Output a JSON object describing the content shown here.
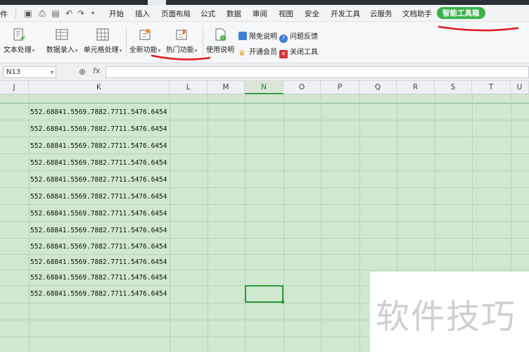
{
  "menubar": {
    "cut_text": "件",
    "items": [
      "开始",
      "插入",
      "页面布局",
      "公式",
      "数据",
      "审阅",
      "视图",
      "安全",
      "开发工具",
      "云服务",
      "文档助手",
      "智能工具箱"
    ],
    "active_item": "智能工具箱"
  },
  "ribbon": {
    "buttons": [
      "文本处理",
      "数据录入",
      "单元格处理",
      "全新功能",
      "热门功能",
      "使用说明"
    ],
    "items": [
      "限免说明",
      "问题反馈",
      "开通会员",
      "关闭工具"
    ]
  },
  "formula_bar": {
    "name_box": "N13",
    "fx_label": "fx",
    "formula": ""
  },
  "columns": [
    "J",
    "K",
    "L",
    "M",
    "N",
    "O",
    "P",
    "Q",
    "R",
    "S",
    "T",
    "U"
  ],
  "selected_column": "N",
  "cells": {
    "column": "K",
    "values": [
      "552.68841.5569.7882.7711.5476.6454",
      "552.68841.5569.7882.7711.5476.6454",
      "552.68841.5569.7882.7711.5476.6454",
      "552.68841.5569.7882.7711.5476.6454",
      "552.68841.5569.7882.7711.5476.6454",
      "552.68841.5569.7882.7711.5476.6454",
      "552.68841.5569.7882.7711.5476.6454",
      "552.68841.5569.7882.7711.5476.6454",
      "552.68841.5569.7882.7711.5476.6454",
      "552.68841.5569.7882.7711.5476.6454",
      "552.68841.5569.7882.7711.5476.6454",
      "552.68841.5569.7882.7711.5476.6454"
    ]
  },
  "watermark": "软件技巧",
  "colors": {
    "accent_green": "#3bb34a",
    "grid_bg": "#cfe8cf",
    "annotation_red": "#e0181b"
  }
}
